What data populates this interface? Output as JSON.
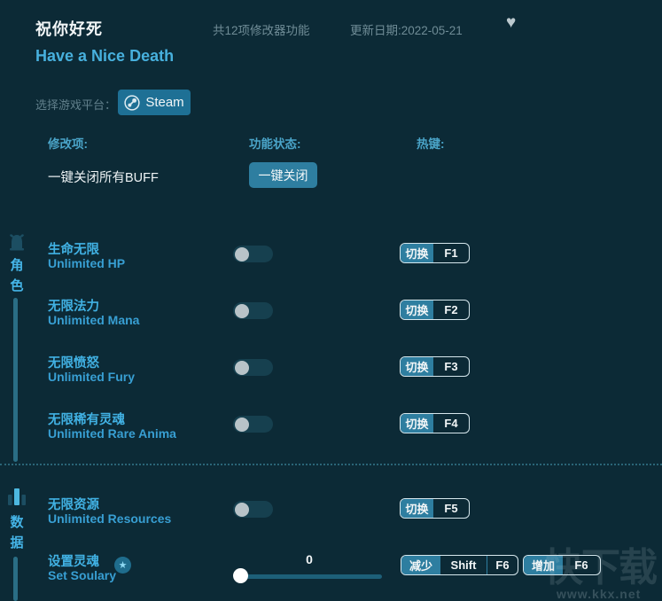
{
  "colors": {
    "background": "#0c2a36",
    "accent_blue": "#41b1e3",
    "teal_button": "#2e7ea0",
    "steam_button": "#1e7095",
    "muted_text": "#6f8c96",
    "white_text": "#f2f6f7",
    "button_border": "#d6e7ed",
    "sidebar_bar": "#2a6e85"
  },
  "header": {
    "title_cn": "祝你好死",
    "title_en": "Have a Nice Death",
    "feature_count": "共12项修改器功能",
    "update_date": "更新日期:2022-05-21",
    "heart_icon": "♥",
    "platform_label": "选择游戏平台：",
    "platform_button": "Steam"
  },
  "columns": {
    "item": "修改项:",
    "status": "功能状态:",
    "hotkey": "热键:"
  },
  "quick_action": {
    "label": "一键关闭所有BUFF",
    "button": "一键关闭"
  },
  "sidebar": {
    "sections": [
      {
        "name": "角色",
        "icon": "helmet-icon",
        "chars": [
          "角",
          "色"
        ]
      },
      {
        "name": "数据",
        "icon": "bar-chart-icon",
        "chars": [
          "数",
          "据"
        ]
      }
    ]
  },
  "rows": [
    {
      "cn": "生命无限",
      "en": "Unlimited HP",
      "toggle_on": false,
      "hotkey_action": "切换",
      "key": "F1"
    },
    {
      "cn": "无限法力",
      "en": "Unlimited Mana",
      "toggle_on": false,
      "hotkey_action": "切换",
      "key": "F2"
    },
    {
      "cn": "无限愤怒",
      "en": "Unlimited Fury",
      "toggle_on": false,
      "hotkey_action": "切换",
      "key": "F3"
    },
    {
      "cn": "无限稀有灵魂",
      "en": "Unlimited Rare Anima",
      "toggle_on": false,
      "hotkey_action": "切换",
      "key": "F4"
    },
    {
      "cn": "无限资源",
      "en": "Unlimited Resources",
      "toggle_on": false,
      "hotkey_action": "切换",
      "key": "F5"
    }
  ],
  "slider_row": {
    "cn": "设置灵魂",
    "en": "Set Soulary",
    "value": "0",
    "star_icon": "★",
    "decrease": {
      "action": "减少",
      "key1": "Shift",
      "key2": "F6"
    },
    "increase": {
      "action": "增加",
      "key": "F6"
    }
  },
  "watermark": {
    "logo_text": "快下载",
    "url": "www.kkx.net"
  }
}
